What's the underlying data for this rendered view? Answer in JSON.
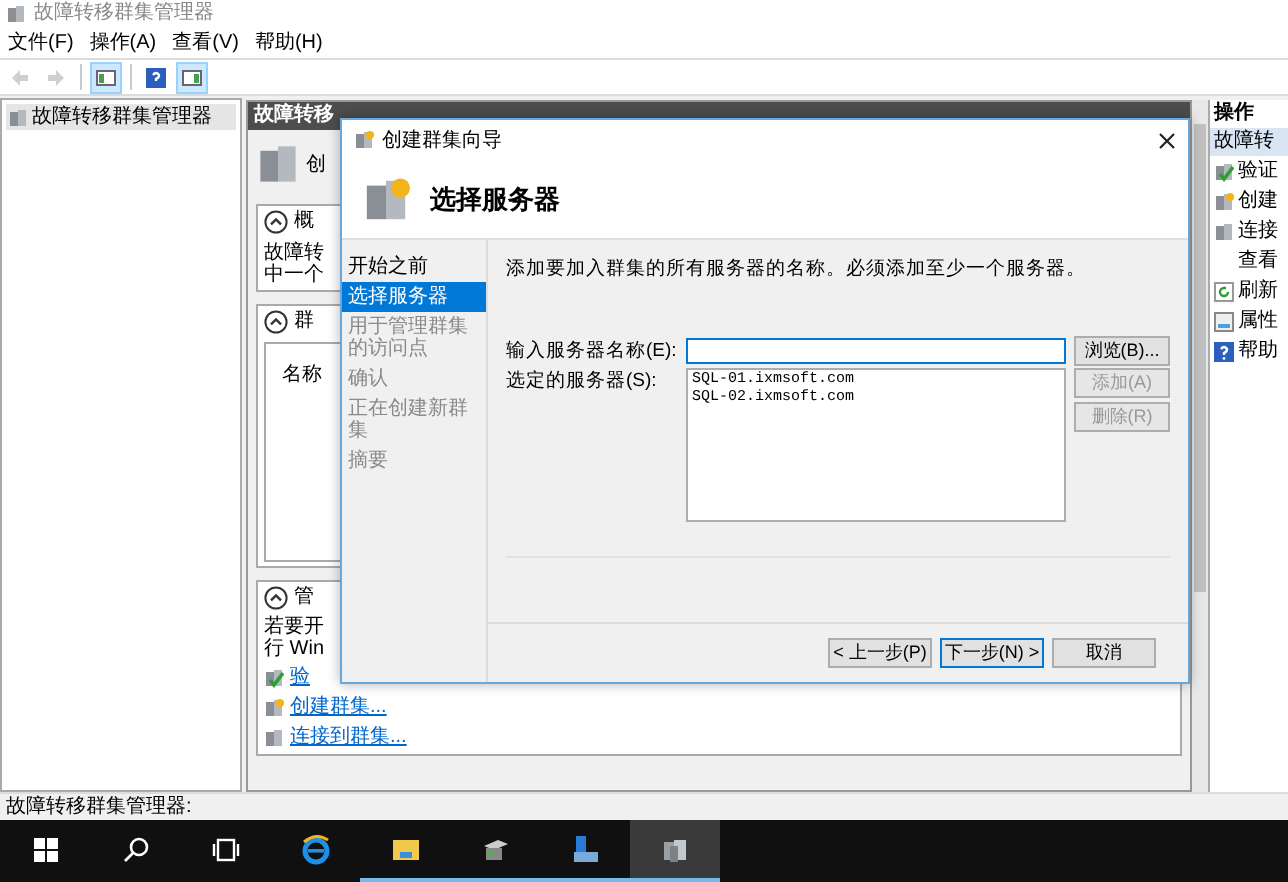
{
  "window": {
    "title": "故障转移群集管理器"
  },
  "menu": [
    "文件(F)",
    "操作(A)",
    "查看(V)",
    "帮助(H)"
  ],
  "toolbar": [
    {
      "kind": "back",
      "disabled": true,
      "pressed": false
    },
    {
      "kind": "forward",
      "disabled": true,
      "pressed": false
    },
    {
      "kind": "tree",
      "disabled": false,
      "pressed": true
    },
    {
      "kind": "help",
      "disabled": false,
      "pressed": false
    },
    {
      "kind": "pane",
      "disabled": false,
      "pressed": true
    }
  ],
  "tree": {
    "items": [
      {
        "label": "故障转移群集管理器",
        "selected": true
      }
    ]
  },
  "center": {
    "header": "故障转移",
    "top_text": "创",
    "sections": [
      {
        "kind": "text",
        "title": "概",
        "expanded": true,
        "lines": [
          "故障转",
          "中一个"
        ]
      },
      {
        "kind": "list",
        "title": "群",
        "expanded": true,
        "column": "名称"
      },
      {
        "kind": "links",
        "title": "管",
        "expanded": true,
        "lines": [
          "若要开",
          "行 Win"
        ],
        "links": [
          {
            "label": "验",
            "kind": "validate"
          },
          {
            "label": "创建群集...",
            "kind": "create"
          },
          {
            "label": "连接到群集...",
            "kind": "connect"
          }
        ]
      }
    ]
  },
  "actions": {
    "title": "操作",
    "group": "故障转",
    "items": [
      {
        "label": "验证",
        "kind": "validate"
      },
      {
        "label": "创建",
        "kind": "create"
      },
      {
        "label": "连接",
        "kind": "connect"
      },
      {
        "label": "查看",
        "kind": "plain"
      },
      {
        "label": "刷新",
        "kind": "refresh"
      },
      {
        "label": "属性",
        "kind": "properties"
      },
      {
        "label": "帮助",
        "kind": "help"
      }
    ]
  },
  "dialog": {
    "title": "创建群集向导",
    "heading": "选择服务器",
    "steps": [
      {
        "label": "开始之前",
        "selected": false,
        "disabled": false
      },
      {
        "label": "选择服务器",
        "selected": true,
        "disabled": false
      },
      {
        "label": "用于管理群集的访问点",
        "selected": false,
        "disabled": true
      },
      {
        "label": "确认",
        "selected": false,
        "disabled": true
      },
      {
        "label": "正在创建新群集",
        "selected": false,
        "disabled": true
      },
      {
        "label": "摘要",
        "selected": false,
        "disabled": true
      }
    ],
    "description": "添加要加入群集的所有服务器的名称。必须添加至少一个服务器。",
    "server_name": {
      "label": "输入服务器名称(E):"
    },
    "browse": {
      "label": "浏览(B)...",
      "disabled": false
    },
    "selected_servers": {
      "label": "选定的服务器(S):",
      "items": [
        "SQL-01.ixmsoft.com",
        "SQL-02.ixmsoft.com"
      ]
    },
    "add": {
      "label": "添加(A)",
      "disabled": true
    },
    "remove": {
      "label": "删除(R)",
      "disabled": true
    },
    "buttons": [
      {
        "label": "< 上一步(P)",
        "default": false
      },
      {
        "label": "下一步(N) >",
        "default": true
      },
      {
        "label": "取消",
        "default": false
      }
    ]
  },
  "status_bar": "故障转移群集管理器:",
  "taskbar": [
    {
      "kind": "start",
      "selected": false,
      "running": false
    },
    {
      "kind": "search",
      "selected": false,
      "running": false
    },
    {
      "kind": "taskview",
      "selected": false,
      "running": false
    },
    {
      "kind": "browser",
      "selected": false,
      "running": false
    },
    {
      "kind": "folder",
      "selected": false,
      "running": true
    },
    {
      "kind": "server",
      "selected": false,
      "running": true
    },
    {
      "kind": "tools",
      "selected": false,
      "running": true
    },
    {
      "kind": "cluster",
      "selected": true,
      "running": true
    }
  ]
}
